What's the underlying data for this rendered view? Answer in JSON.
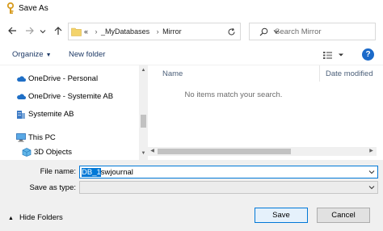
{
  "window": {
    "title": "Save As"
  },
  "nav": {
    "back_icon": "arrow-left-icon",
    "forward_icon": "arrow-right-icon",
    "recent_icon": "chevron-down-icon",
    "up_icon": "arrow-up-icon"
  },
  "address": {
    "overflow": "«",
    "crumbs": [
      "_MyDatabases",
      "Mirror"
    ]
  },
  "search": {
    "placeholder": "Search Mirror"
  },
  "toolbar": {
    "organize": "Organize",
    "new_folder": "New folder",
    "help": "?"
  },
  "tree": {
    "items": [
      {
        "label": "OneDrive - Personal",
        "icon": "cloud-icon"
      },
      {
        "label": "OneDrive - Systemite AB",
        "icon": "cloud-icon"
      },
      {
        "label": "Systemite AB",
        "icon": "building-icon"
      },
      {
        "label": "This PC",
        "icon": "computer-icon"
      },
      {
        "label": "3D Objects",
        "icon": "cube-icon"
      }
    ]
  },
  "list": {
    "columns": {
      "name": "Name",
      "date_modified": "Date modified"
    },
    "empty_message": "No items match your search."
  },
  "form": {
    "file_name_label": "File name:",
    "file_name_selected": "DB_1",
    "file_name_rest": "swjournal",
    "save_as_type_label": "Save as type:",
    "save_as_type_value": ""
  },
  "footer": {
    "hide_folders": "Hide Folders",
    "save": "Save",
    "cancel": "Cancel"
  },
  "colors": {
    "accent": "#0078d7",
    "link": "#1e3a66",
    "help": "#1b6ac9"
  }
}
